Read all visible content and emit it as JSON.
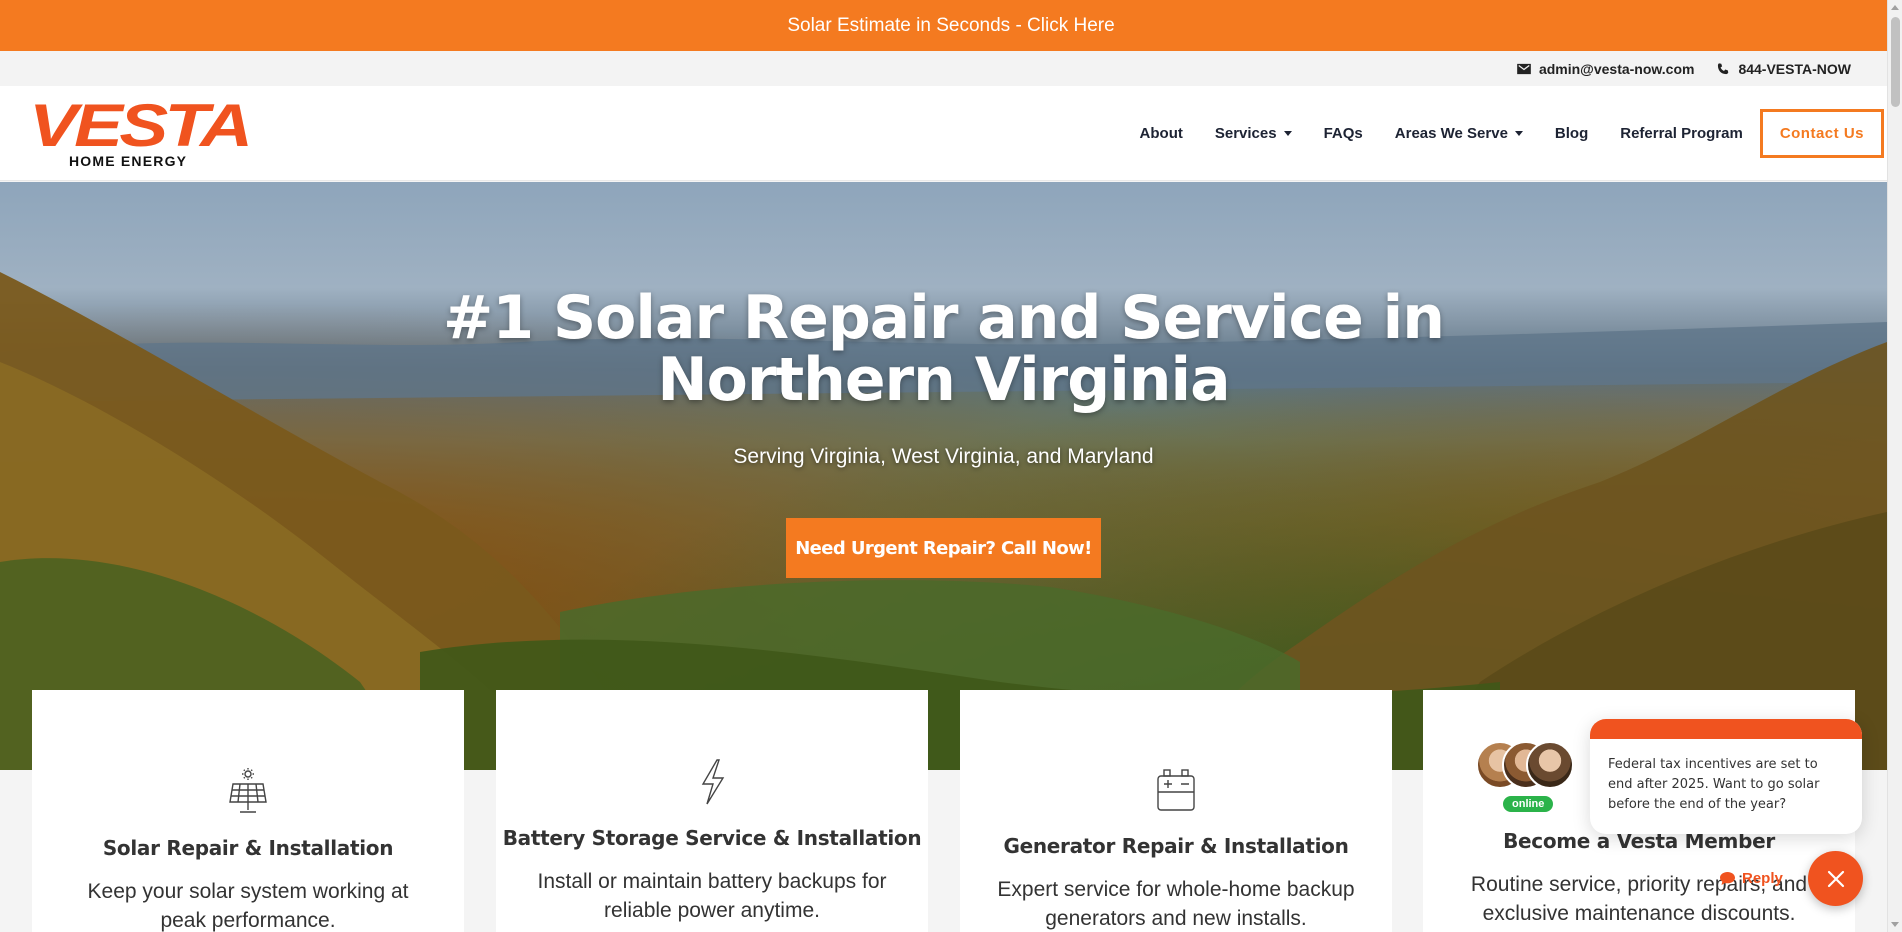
{
  "promo_bar": {
    "text": "Solar Estimate in Seconds - Click Here"
  },
  "contact": {
    "email": "admin@vesta-now.com",
    "phone": "844-VESTA-NOW"
  },
  "logo": {
    "word": "VESTA",
    "sub": "HOME ENERGY",
    "brand_color": "#f0531f"
  },
  "nav": {
    "items": [
      {
        "label": "About",
        "has_dropdown": false
      },
      {
        "label": "Services",
        "has_dropdown": true
      },
      {
        "label": "FAQs",
        "has_dropdown": false
      },
      {
        "label": "Areas We Serve",
        "has_dropdown": true
      },
      {
        "label": "Blog",
        "has_dropdown": false
      },
      {
        "label": "Referral Program",
        "has_dropdown": false
      }
    ],
    "contact_button": "Contact Us"
  },
  "hero": {
    "title_line1": "#1 Solar Repair and Service in",
    "title_line2": "Northern Virginia",
    "subtitle": "Serving Virginia, West Virginia, and Maryland",
    "cta": "Need Urgent Repair? Call Now!",
    "accent": "#f47a20"
  },
  "cards": [
    {
      "icon": "solar-panel-icon",
      "title": "Solar Repair & Installation",
      "text": "Keep your solar system working at peak performance."
    },
    {
      "icon": "lightning-icon",
      "title": "Battery Storage Service & Installation",
      "text": "Install or maintain battery backups for reliable power anytime."
    },
    {
      "icon": "battery-icon",
      "title": "Generator Repair & Installation",
      "text": "Expert service for whole-home backup generators and new installs."
    },
    {
      "icon": "member-icon",
      "title": "Become a Vesta Member",
      "text": "Routine service, priority repairs, and exclusive maintenance discounts."
    }
  ],
  "chat": {
    "message": "Federal tax incentives are set to end after 2025. Want to go solar before the end of the year?",
    "status": "online",
    "reply": "Reply"
  }
}
